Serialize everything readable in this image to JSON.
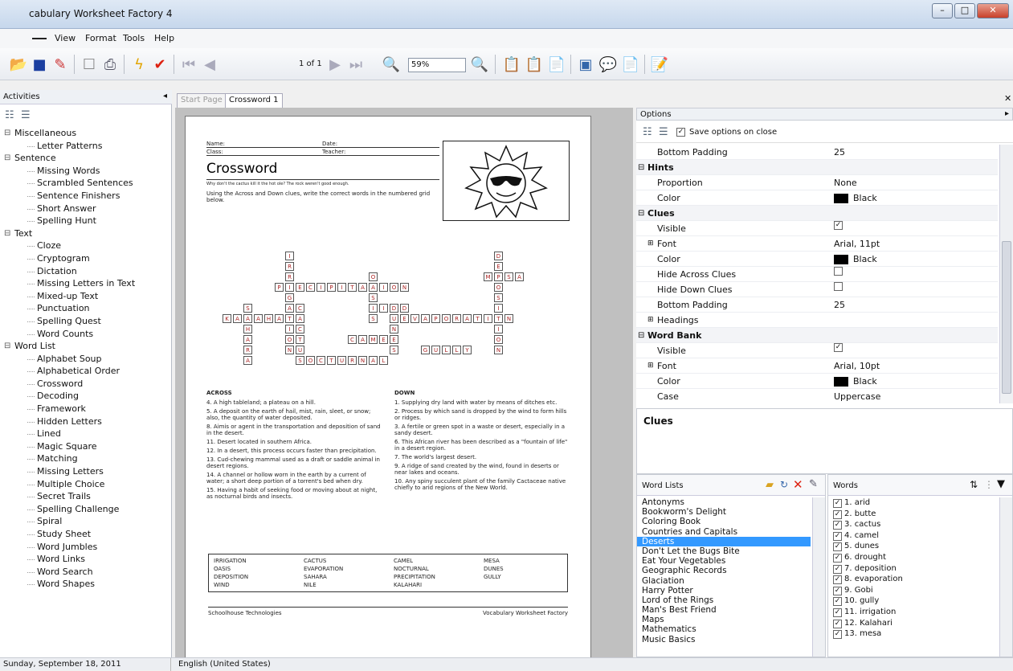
{
  "window": {
    "title": "cabulary Worksheet Factory 4",
    "controls": [
      "–",
      "□",
      "✕"
    ]
  },
  "menu": [
    "View",
    "Format",
    "Tools",
    "Help"
  ],
  "toolbar": {
    "page_indicator": "1 of 1",
    "zoom": "59%"
  },
  "activities": {
    "title": "Activities",
    "tree": [
      {
        "label": "Miscellaneous",
        "items": [
          "Letter Patterns"
        ]
      },
      {
        "label": "Sentence",
        "items": [
          "Missing Words",
          "Scrambled Sentences",
          "Sentence Finishers",
          "Short Answer",
          "Spelling Hunt"
        ]
      },
      {
        "label": "Text",
        "items": [
          "Cloze",
          "Cryptogram",
          "Dictation",
          "Missing Letters in Text",
          "Mixed-up Text",
          "Punctuation",
          "Spelling Quest",
          "Word Counts"
        ]
      },
      {
        "label": "Word List",
        "items": [
          "Alphabet Soup",
          "Alphabetical Order",
          "Crossword",
          "Decoding",
          "Framework",
          "Hidden Letters",
          "Lined",
          "Magic Square",
          "Matching",
          "Missing Letters",
          "Multiple Choice",
          "Secret Trails",
          "Spelling Challenge",
          "Spiral",
          "Study Sheet",
          "Word Jumbles",
          "Word Links",
          "Word Search",
          "Word Shapes"
        ]
      }
    ]
  },
  "tabs": [
    "Start Page",
    "Crossword 1"
  ],
  "worksheet": {
    "name_label": "Name:",
    "date_label": "Date:",
    "class_label": "Class:",
    "teacher_label": "Teacher:",
    "title": "Crossword",
    "tagline": "Why don't the cactus kill it the hot ole? The rock weren't good enough.",
    "instructions": "Using the Across and Down clues, write the correct words in the numbered grid below.",
    "across_title": "ACROSS",
    "across": [
      "4. A high tableland; a plateau on a hill.",
      "5. A deposit on the earth of hail, mist, rain, sleet, or snow; also, the quantity of water deposited.",
      "8. Aimis or agent in the transportation and deposition of sand in the desert.",
      "11. Desert located in southern Africa.",
      "12. In a desert, this process occurs faster than precipitation.",
      "13. Cud-chewing mammal used as a draft or saddle animal in desert regions.",
      "14. A channel or hollow worn in the earth by a current of water; a short deep portion of a torrent's bed when dry.",
      "15. Having a habit of seeking food or moving about at night, as nocturnal birds and insects."
    ],
    "down_title": "DOWN",
    "down": [
      "1. Supplying dry land with water by means of ditches etc.",
      "2. Process by which sand is dropped by the wind to form hills or ridges.",
      "3. A fertile or green spot in a waste or desert, especially in a sandy desert.",
      "6. This African river has been described as a \"fountain of life\" in a desert region.",
      "7. The world's largest desert.",
      "9. A ridge of sand created by the wind, found in deserts or near lakes and oceans.",
      "10. Any spiny succulent plant of the family Cactaceae native chiefly to arid regions of the New World."
    ],
    "word_bank": [
      "IRRIGATION",
      "CACTUS",
      "CAMEL",
      "MESA",
      "OASIS",
      "EVAPORATION",
      "NOCTURNAL",
      "DUNES",
      "DEPOSITION",
      "SAHARA",
      "PRECIPITATION",
      "GULLY",
      "WIND",
      "NILE",
      "KALAHARI"
    ],
    "footer_left": "Schoolhouse Technologies",
    "footer_right": "Vocabulary Worksheet Factory",
    "grid_across": [
      {
        "n": "",
        "word": "MESA",
        "r": 2,
        "c": 25
      },
      {
        "n": "5",
        "word": "PRECIPITATION",
        "r": 3,
        "c": 5
      },
      {
        "n": "",
        "word": "WIND",
        "r": 5,
        "c": 14
      },
      {
        "n": "11",
        "word": "KALAHARI",
        "r": 6,
        "c": 0
      },
      {
        "n": "",
        "word": "EVAPORATION",
        "r": 6,
        "c": 17
      },
      {
        "n": "13",
        "word": "CAMEL",
        "r": 8,
        "c": 12
      },
      {
        "n": "",
        "word": "GULLY",
        "r": 9,
        "c": 19
      },
      {
        "n": "15",
        "word": "NOCTURNAL",
        "r": 10,
        "c": 7
      }
    ],
    "grid_down": [
      {
        "n": "",
        "word": "IRRIGATION",
        "r": 0,
        "c": 6
      },
      {
        "n": "",
        "word": "DEPOSITION",
        "r": 0,
        "c": 26
      },
      {
        "n": "",
        "word": "CACTUS",
        "r": 5,
        "c": 7
      },
      {
        "n": "",
        "word": "OASIS",
        "r": 2,
        "c": 14
      },
      {
        "n": "",
        "word": "DUNES",
        "r": 5,
        "c": 16
      },
      {
        "n": "",
        "word": "SAHARA",
        "r": 5,
        "c": 2
      }
    ]
  },
  "options": {
    "title": "Options",
    "save_on_close": "Save options on close",
    "rows": [
      {
        "type": "prop",
        "label": "Bottom Padding",
        "value": "25"
      },
      {
        "type": "section",
        "label": "Hints"
      },
      {
        "type": "prop",
        "label": "Proportion",
        "value": "None"
      },
      {
        "type": "color",
        "label": "Color",
        "value": "Black"
      },
      {
        "type": "section",
        "label": "Clues"
      },
      {
        "type": "check",
        "label": "Visible",
        "checked": true
      },
      {
        "type": "prop",
        "label": "Font",
        "value": "Arial, 11pt",
        "expand": true
      },
      {
        "type": "color",
        "label": "Color",
        "value": "Black"
      },
      {
        "type": "check",
        "label": "Hide Across Clues",
        "checked": false
      },
      {
        "type": "check",
        "label": "Hide Down Clues",
        "checked": false
      },
      {
        "type": "prop",
        "label": "Bottom Padding",
        "value": "25"
      },
      {
        "type": "prop",
        "label": "Headings",
        "value": "",
        "expand": true
      },
      {
        "type": "section",
        "label": "Word Bank"
      },
      {
        "type": "check",
        "label": "Visible",
        "checked": true
      },
      {
        "type": "prop",
        "label": "Font",
        "value": "Arial, 10pt",
        "expand": true
      },
      {
        "type": "color",
        "label": "Color",
        "value": "Black"
      },
      {
        "type": "prop",
        "label": "Case",
        "value": "Uppercase"
      }
    ]
  },
  "clues_panel": {
    "title": "Clues"
  },
  "word_lists": {
    "title": "Word Lists",
    "selected": "Deserts",
    "items": [
      "Antonyms",
      "Bookworm's Delight",
      "Coloring Book",
      "Countries and Capitals",
      "Deserts",
      "Don't Let the Bugs Bite",
      "Eat Your Vegetables",
      "Geographic Records",
      "Glaciation",
      "Harry Potter",
      "Lord of the Rings",
      "Man's Best Friend",
      "Maps",
      "Mathematics",
      "Music Basics"
    ]
  },
  "words": {
    "title": "Words",
    "items": [
      "1. arid",
      "2. butte",
      "3. cactus",
      "4. camel",
      "5. dunes",
      "6. drought",
      "7. deposition",
      "8. evaporation",
      "9. Gobi",
      "10. gully",
      "11. irrigation",
      "12. Kalahari",
      "13. mesa"
    ]
  },
  "status": {
    "date": "Sunday, September 18, 2011",
    "language": "English (United States)"
  }
}
